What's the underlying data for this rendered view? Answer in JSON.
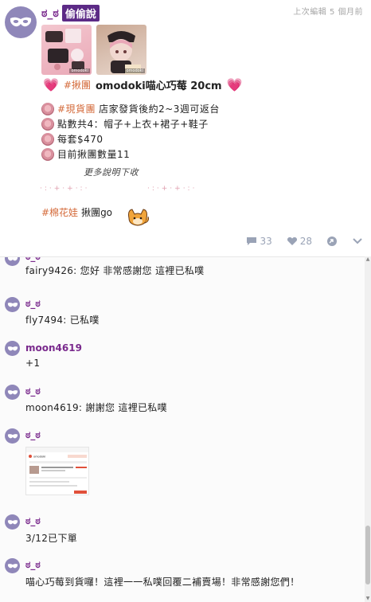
{
  "post": {
    "author": "ಠ_ಠ",
    "badge": "偷偷說",
    "edit_time": "上次編輯 5 個月前",
    "photo_tag": "omodoki",
    "title": {
      "hashtag": "#揪團",
      "text": "omodoki喵心巧莓 20cm"
    },
    "bullets": [
      {
        "hashtag": "#現貨團",
        "text": " 店家發貨後約2~3週可返台"
      },
      {
        "hashtag": "",
        "text": "點數共4：帽子+上衣+裙子+鞋子"
      },
      {
        "hashtag": "",
        "text": "每套$470"
      },
      {
        "hashtag": "",
        "text": "目前揪團數量11"
      }
    ],
    "note": "更多說明下收",
    "dots": "·:·+·+·:·",
    "last_line": {
      "hashtag": "#棉花娃",
      "text": " 揪團go"
    },
    "actions": {
      "comments_count": "33",
      "likes_count": "28"
    }
  },
  "comments": [
    {
      "name": "ಠ_ಠ",
      "text": "fairy9426: 您好 非常感謝您 這裡已私噗"
    },
    {
      "name": "ಠ_ಠ",
      "text": "fly7494: 已私噗"
    },
    {
      "name": "moon4619",
      "text": "+1"
    },
    {
      "name": "ಠ_ಠ",
      "text": "moon4619: 謝謝您 這裡已私噗"
    },
    {
      "name": "ಠ_ಠ",
      "image_shop": "omodoki"
    },
    {
      "name": "ಠ_ಠ",
      "text": "3/12已下單"
    },
    {
      "name": "ಠ_ಠ",
      "text": "喵心巧莓到貨囉！這裡一一私噗回覆二補賣場！非常感謝您們！"
    }
  ],
  "colors": {
    "name": "#7a2a8d",
    "badge": "#5c2a86",
    "avatar": "#8f87b9",
    "hashtag": "#d46a3a",
    "action": "#9aa3b6"
  },
  "icons": [
    "mask-avatar-icon",
    "heart-icon",
    "rose-icon",
    "comment-icon",
    "like-icon",
    "replurk-icon",
    "chevron-down-icon",
    "fox-mascot-icon"
  ]
}
